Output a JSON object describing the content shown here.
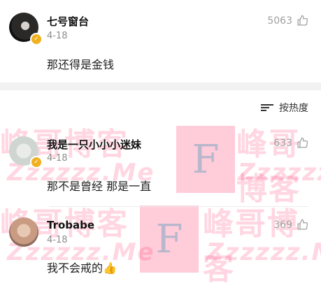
{
  "comments": [
    {
      "name": "七号窗台",
      "date": "4-18",
      "text": "那还得是金钱",
      "likes": "5063"
    },
    {
      "name": "我是一只小小小迷妹",
      "date": "4-18",
      "text": "那不是曾经 那是一直",
      "likes": "633"
    },
    {
      "name": "Trobabe",
      "date": "4-18",
      "text": "我不会戒的👍",
      "likes": "369"
    }
  ],
  "sort": {
    "label": "按热度"
  },
  "watermarks": {
    "cn": "峰哥博客",
    "en": "Zzzzzz.Me",
    "f": "F"
  },
  "colors": {
    "badge": "#f1b01f",
    "divider": "#f2f2f2",
    "watermark": "#ff0048"
  }
}
